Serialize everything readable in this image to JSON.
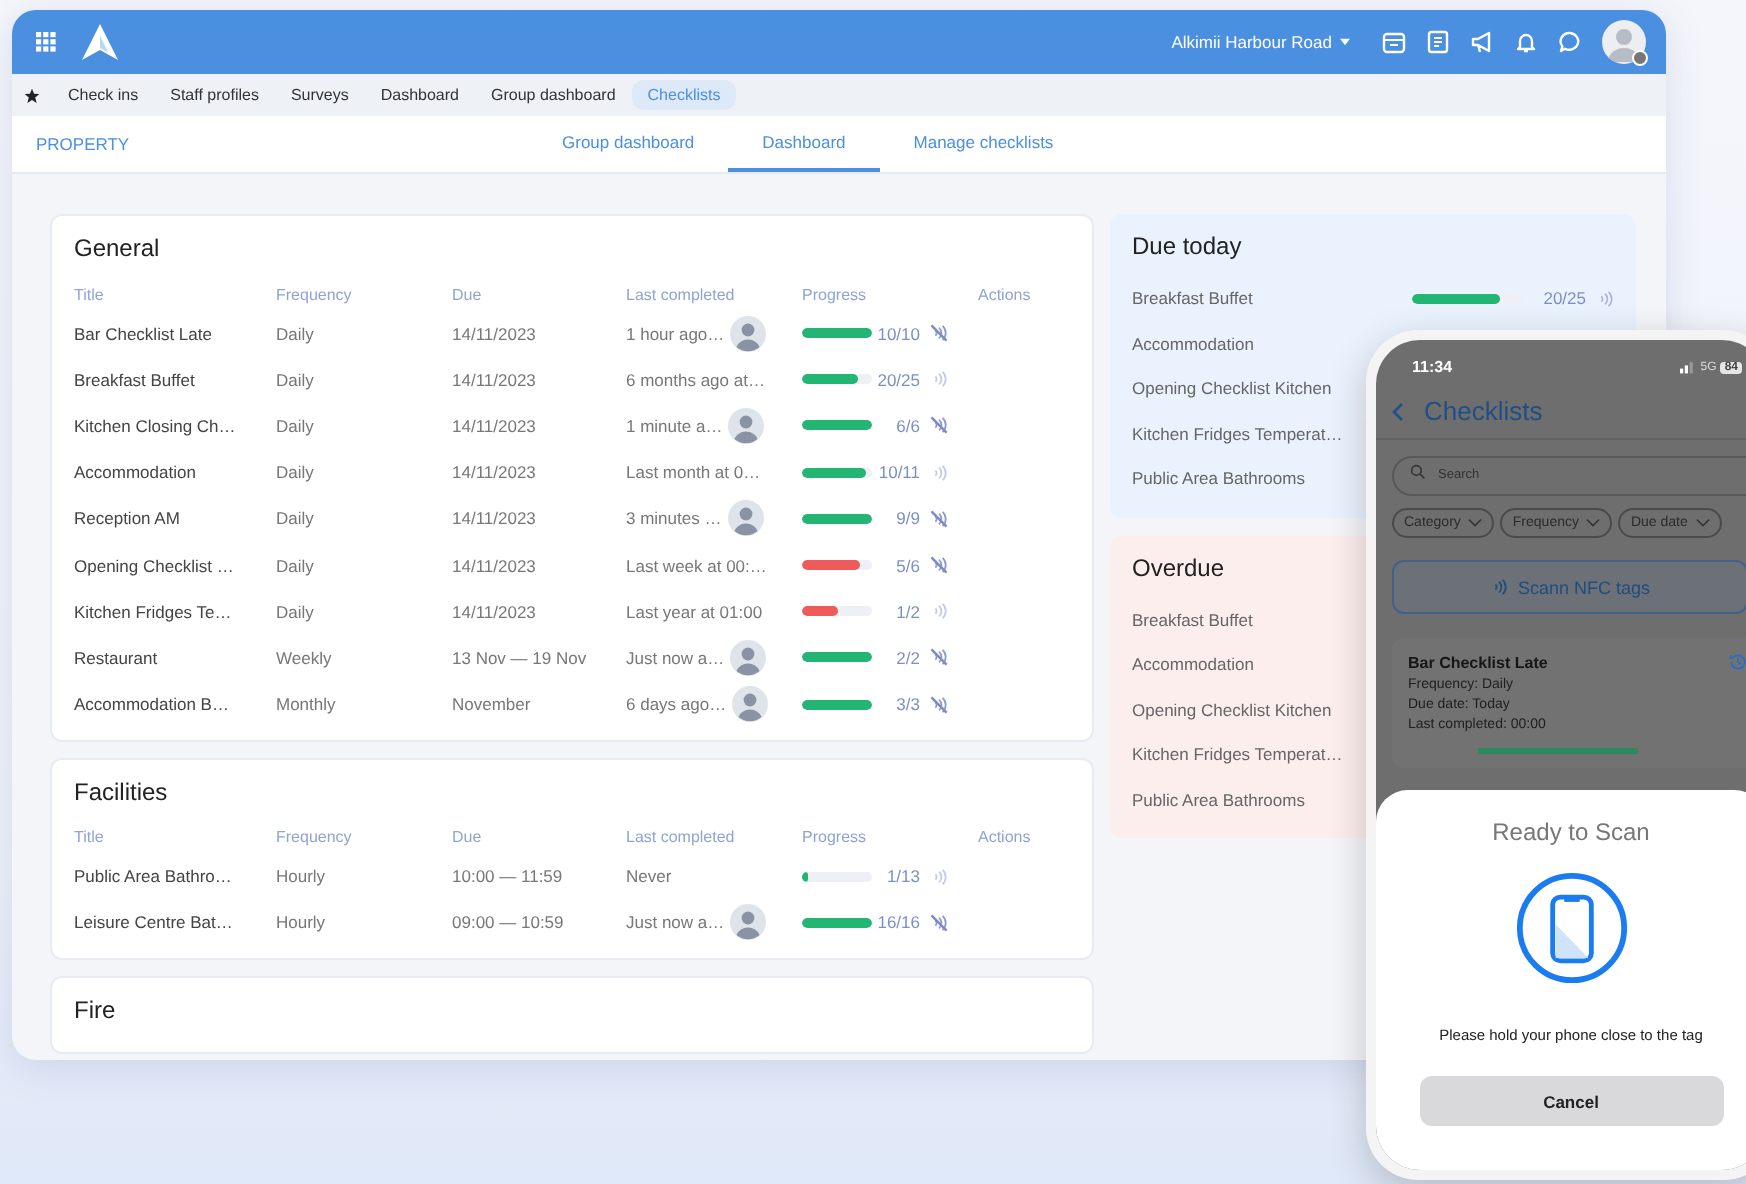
{
  "topbar": {
    "location": "Alkimii Harbour Road"
  },
  "nav": [
    {
      "label": "Check ins",
      "selected": false
    },
    {
      "label": "Staff profiles",
      "selected": false
    },
    {
      "label": "Surveys",
      "selected": false
    },
    {
      "label": "Dashboard",
      "selected": false
    },
    {
      "label": "Group dashboard",
      "selected": false
    },
    {
      "label": "Checklists",
      "selected": true
    }
  ],
  "subnav": {
    "section": "PROPERTY",
    "tabs": [
      {
        "label": "Group dashboard",
        "selected": false
      },
      {
        "label": "Dashboard",
        "selected": true
      },
      {
        "label": "Manage checklists",
        "selected": false
      }
    ]
  },
  "sections": [
    {
      "title": "General",
      "columns": [
        "Title",
        "Frequency",
        "Due",
        "Last completed",
        "Progress",
        "Actions"
      ],
      "rows": [
        {
          "title": "Bar Checklist Late",
          "frequency": "Daily",
          "due": "14/11/2023",
          "last_completed": "1 hour ago…",
          "avatar": true,
          "level": 1,
          "reading": "10/10",
          "color": "#22b573",
          "nfc_disabled": true
        },
        {
          "title": "Breakfast Buffet",
          "frequency": "Daily",
          "due": "14/11/2023",
          "last_completed": "6 months ago at…",
          "avatar": false,
          "level": 0.8,
          "reading": "20/25",
          "color": "#22b573",
          "nfc_disabled": false
        },
        {
          "title": "Kitchen Closing Ch…",
          "frequency": "Daily",
          "due": "14/11/2023",
          "last_completed": "1 minute a…",
          "avatar": true,
          "level": 1,
          "reading": "6/6",
          "color": "#22b573",
          "nfc_disabled": true
        },
        {
          "title": "Accommodation",
          "frequency": "Daily",
          "due": "14/11/2023",
          "last_completed": "Last month at 0…",
          "avatar": false,
          "level": 0.91,
          "reading": "10/11",
          "color": "#22b573",
          "nfc_disabled": false
        },
        {
          "title": "Reception AM",
          "frequency": "Daily",
          "due": "14/11/2023",
          "last_completed": "3 minutes …",
          "avatar": true,
          "level": 1,
          "reading": "9/9",
          "color": "#22b573",
          "nfc_disabled": true
        },
        {
          "title": "Opening Checklist …",
          "frequency": "Daily",
          "due": "14/11/2023",
          "last_completed": "Last week at 00:…",
          "avatar": false,
          "level": 0.83,
          "reading": "5/6",
          "color": "#ef5a5a",
          "nfc_disabled": true
        },
        {
          "title": "Kitchen Fridges Te…",
          "frequency": "Daily",
          "due": "14/11/2023",
          "last_completed": "Last year at 01:00",
          "avatar": false,
          "level": 0.5,
          "reading": "1/2",
          "color": "#ef5a5a",
          "nfc_disabled": false
        },
        {
          "title": "Restaurant",
          "frequency": "Weekly",
          "due": "13 Nov — 19 Nov",
          "last_completed": "Just now a…",
          "avatar": true,
          "level": 1,
          "reading": "2/2",
          "color": "#22b573",
          "nfc_disabled": true
        },
        {
          "title": "Accommodation B…",
          "frequency": "Monthly",
          "due": "November",
          "last_completed": "6 days ago…",
          "avatar": true,
          "level": 1,
          "reading": "3/3",
          "color": "#22b573",
          "nfc_disabled": true
        }
      ]
    },
    {
      "title": "Facilities",
      "columns": [
        "Title",
        "Frequency",
        "Due",
        "Last completed",
        "Progress",
        "Actions"
      ],
      "rows": [
        {
          "title": "Public Area Bathro…",
          "frequency": "Hourly",
          "due": "10:00 — 11:59",
          "last_completed": "Never",
          "avatar": false,
          "level": 0.08,
          "reading": "1/13",
          "color": "#22b573",
          "nfc_disabled": false
        },
        {
          "title": "Leisure Centre Bat…",
          "frequency": "Hourly",
          "due": "09:00 — 10:59",
          "last_completed": "Just now a…",
          "avatar": true,
          "level": 1,
          "reading": "16/16",
          "color": "#22b573",
          "nfc_disabled": true
        }
      ]
    },
    {
      "title": "Fire"
    }
  ],
  "due_today": {
    "title": "Due today",
    "items": [
      {
        "name": "Breakfast Buffet",
        "level": 0.8,
        "reading": "20/25"
      },
      {
        "name": "Accommodation"
      },
      {
        "name": "Opening Checklist Kitchen"
      },
      {
        "name": "Kitchen Fridges Temperat…"
      },
      {
        "name": "Public Area Bathrooms"
      }
    ]
  },
  "overdue": {
    "title": "Overdue",
    "items": [
      {
        "name": "Breakfast Buffet"
      },
      {
        "name": "Accommodation"
      },
      {
        "name": "Opening Checklist Kitchen"
      },
      {
        "name": "Kitchen Fridges Temperat…"
      },
      {
        "name": "Public Area Bathrooms"
      }
    ]
  },
  "phone": {
    "time": "11:34",
    "network": "5G",
    "battery": "84",
    "title": "Checklists",
    "search_placeholder": "Search",
    "filters": [
      "Category",
      "Frequency",
      "Due date"
    ],
    "scan_button": "Scann NFC tags",
    "card": {
      "title": "Bar Checklist Late",
      "lines": [
        "Frequency: Daily",
        "Due date: Today",
        "Last completed: 00:00"
      ],
      "level": 1
    },
    "sheet": {
      "title": "Ready to Scan",
      "message": "Please hold your phone close to the tag",
      "button": "Cancel"
    }
  }
}
